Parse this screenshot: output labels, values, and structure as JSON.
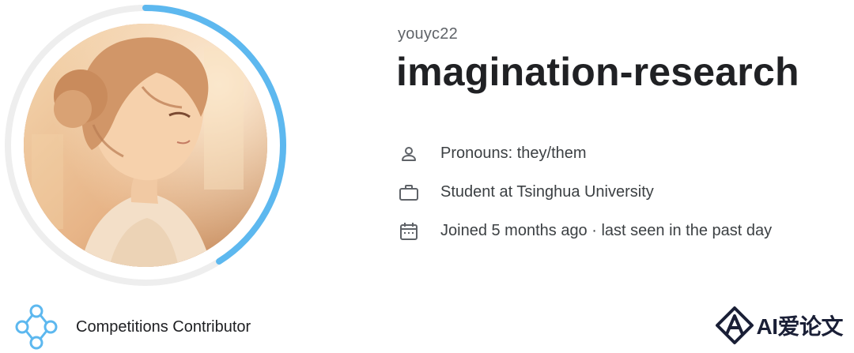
{
  "profile": {
    "username": "youyc22",
    "display_name": "imagination-research",
    "avatar_alt": "profile avatar illustration",
    "progress_ring_fraction": 0.41,
    "colors": {
      "ring_track": "#eeeeee",
      "ring_progress": "#5db8ef"
    }
  },
  "details": [
    {
      "icon": "person-icon",
      "text": "Pronouns: they/them"
    },
    {
      "icon": "briefcase-icon",
      "text": "Student at Tsinghua University"
    },
    {
      "icon": "calendar-icon",
      "text": "Joined 5 months ago · last seen in the past day"
    }
  ],
  "badge": {
    "icon": "competitions-contributor-icon",
    "label": "Competitions Contributor",
    "color": "#5db8ef"
  },
  "watermark": {
    "text": "AI爱论文"
  }
}
